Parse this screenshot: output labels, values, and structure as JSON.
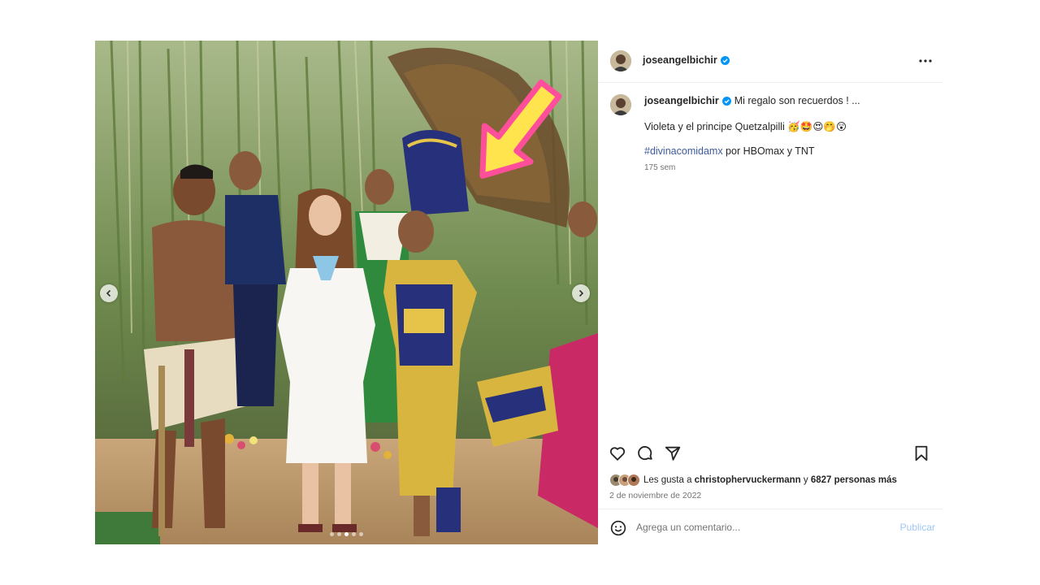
{
  "post": {
    "username": "joseangelbichir",
    "verified": true,
    "caption_title": "Mi regalo son recuerdos ! ...",
    "caption_line2": "Violeta y el principe Quetzalpilli 🥳🤩😍🤭😲",
    "hashtag": "#divinacomidamx",
    "caption_line3_rest": " por HBOmax y TNT",
    "time_ago": "175 sem",
    "likes_prefix": "Les gusta a ",
    "likes_user": "christophervuckermann",
    "likes_mid": " y ",
    "likes_count": "6827 personas más",
    "date": "2 de noviembre de 2022"
  },
  "carousel": {
    "total_slides": 5,
    "active_index": 2
  },
  "comment_box": {
    "placeholder": "Agrega un comentario...",
    "publish_label": "Publicar"
  },
  "colors": {
    "verified_blue": "#0095f6",
    "hashtag": "#3d5a9e",
    "publish_disabled": "#9fc7f5",
    "arrow_pink": "#ff4f9a",
    "arrow_yellow": "#ffe44d"
  },
  "icons": {
    "like": "heart-icon",
    "comment": "comment-bubble-icon",
    "share": "paper-plane-icon",
    "save": "bookmark-icon",
    "more": "ellipsis-icon",
    "emoji": "smiley-icon",
    "prev": "chevron-left-icon",
    "next": "chevron-right-icon"
  }
}
